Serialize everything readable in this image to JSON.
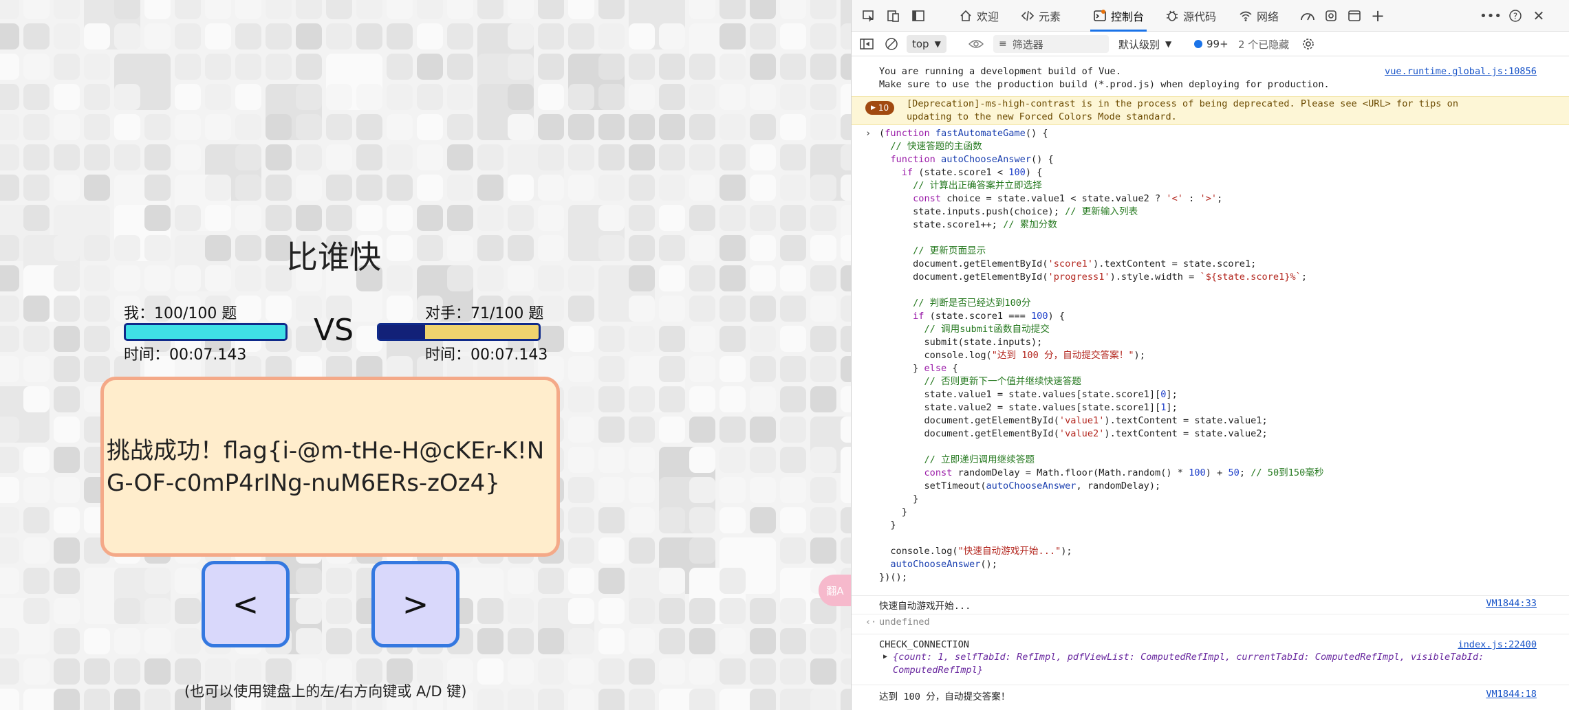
{
  "game": {
    "title": "比谁快",
    "me_label": "我：100/100 题",
    "me_time": "时间：00:07.143",
    "me_progress": 1.0,
    "opp_label": "对手：71/100 题",
    "opp_time": "时间：00:07.143",
    "opp_progress": 0.71,
    "vs": "VS",
    "result": "挑战成功！flag{i-@m-tHe-H@cKEr-K!NG-OF-c0mP4rINg-nuM6ERs-zOz4}",
    "left_button": "<",
    "right_button": ">",
    "hint": "(也可以使用键盘上的左/右方向键或 A/D 键)",
    "translate_icon": "翻A",
    "colors": {
      "me_fill": "#3fe0e6",
      "opp_fill": "#efd36e",
      "bar_border": "#0f2a8a",
      "result_bg": "#ffedcc",
      "result_border": "#f4a988",
      "button_bg": "#d9d8fb",
      "button_border": "#3478e0"
    }
  },
  "devtools": {
    "tabs": [
      {
        "label": "欢迎",
        "icon": "home-icon"
      },
      {
        "label": "元素",
        "icon": "code-icon"
      },
      {
        "label": "控制台",
        "icon": "console-icon",
        "active": true
      },
      {
        "label": "源代码",
        "icon": "bug-icon"
      },
      {
        "label": "网络",
        "icon": "wifi-icon"
      }
    ],
    "toolbar": {
      "context": "top",
      "filter_placeholder": "筛选器",
      "level": "默认级别",
      "issues": "99+",
      "hidden": "2 个已隐藏"
    },
    "console": {
      "vue_line1": "You are running a development build of Vue.",
      "vue_line2": "Make sure to use the production build (*.prod.js) when deploying for production.",
      "vue_link": "vue.runtime.global.js:10856",
      "warn_count": "10",
      "warn_line1": "[Deprecation]-ms-high-contrast is in the process of being deprecated. Please see <URL> for tips on",
      "warn_line2": "updating to the new Forced Colors Mode standard.",
      "code": [
        "(function fastAutomateGame() {",
        "  // 快速答题的主函数",
        "  function autoChooseAnswer() {",
        "    if (state.score1 < 100) {",
        "      // 计算出正确答案并立即选择",
        "      const choice = state.value1 < state.value2 ? '<' : '>';",
        "      state.inputs.push(choice); // 更新输入列表",
        "      state.score1++; // 累加分数",
        "",
        "      // 更新页面显示",
        "      document.getElementById('score1').textContent = state.score1;",
        "      document.getElementById('progress1').style.width = `${state.score1}%`;",
        "",
        "      // 判断是否已经达到100分",
        "      if (state.score1 === 100) {",
        "        // 调用submit函数自动提交",
        "        submit(state.inputs);",
        "        console.log(\"达到 100 分，自动提交答案！\");",
        "      } else {",
        "        // 否则更新下一个值并继续快速答题",
        "        state.value1 = state.values[state.score1][0];",
        "        state.value2 = state.values[state.score1][1];",
        "        document.getElementById('value1').textContent = state.value1;",
        "        document.getElementById('value2').textContent = state.value2;",
        "",
        "        // 立即递归调用继续答题",
        "        const randomDelay = Math.floor(Math.random() * 100) + 50; // 50到150毫秒",
        "        setTimeout(autoChooseAnswer, randomDelay);",
        "      }",
        "    }",
        "  }",
        "",
        "  console.log(\"快速自动游戏开始...\");",
        "  autoChooseAnswer();",
        "})();"
      ],
      "log_start": "快速自动游戏开始...",
      "log_start_link": "VM1844:33",
      "undefined_text": "undefined",
      "check_conn": "CHECK_CONNECTION",
      "check_conn_link": "index.js:22400",
      "obj_line1": "{count: 1, selfTabId: RefImpl, pdfViewList: ComputedRefImpl, currentTabId: ComputedRefImpl, visibleTabId:",
      "obj_line2": "ComputedRefImpl}",
      "log_done": "达到 100 分，自动提交答案！",
      "log_done_link": "VM1844:18"
    }
  }
}
